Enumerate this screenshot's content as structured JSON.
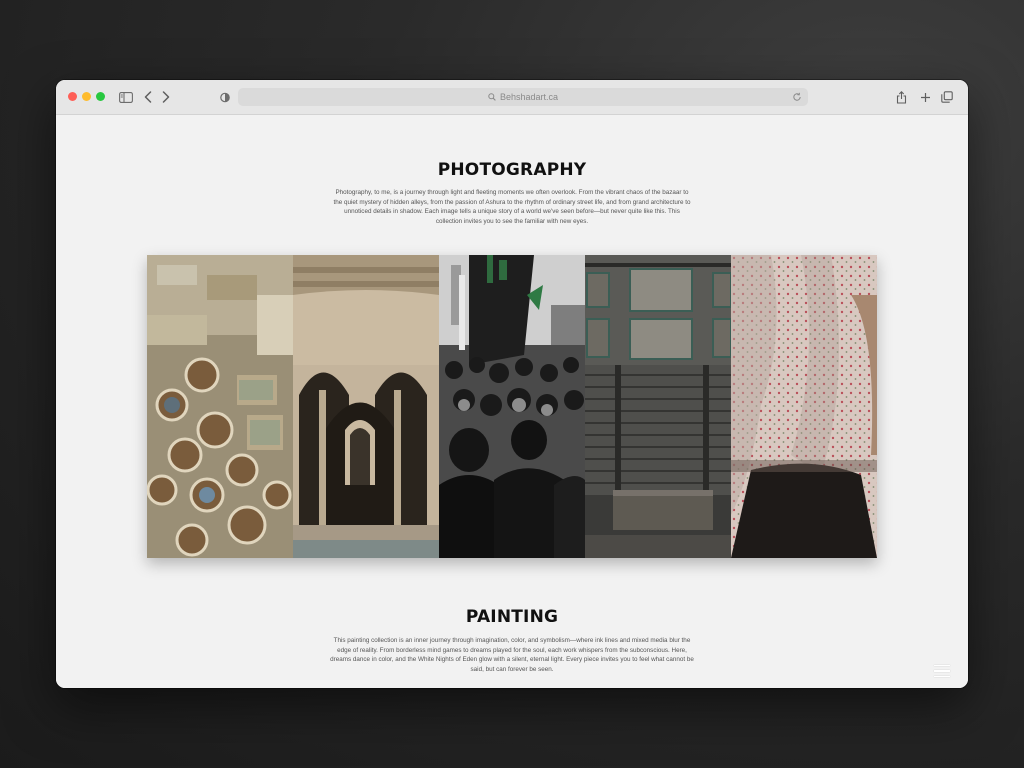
{
  "browser": {
    "url": "Behshadart.ca",
    "traffic_lights": {
      "close": "#fe5f57",
      "minimize": "#febc2e",
      "zoom": "#28c840"
    },
    "icons": {
      "sidebar": "sidebar-icon",
      "back": "chevron-left-icon",
      "forward": "chevron-right-icon",
      "privacy": "shield-icon",
      "search": "search-icon",
      "reload": "reload-icon",
      "share": "share-icon",
      "new_tab": "plus-icon",
      "tabs": "tab-overview-icon"
    }
  },
  "photography": {
    "title": "PHOTOGRAPHY",
    "description": "Photography, to me, is a journey through light and fleeting moments we often overlook. From the vibrant chaos of the bazaar to the quiet mystery of hidden alleys, from the passion of Ashura to the rhythm of ordinary street life, and from grand architecture to unnoticed details in shadow. Each image tells a unique story of a world we've seen before—but never quite like this. This collection invites you to see the familiar with new eyes.",
    "gallery": [
      "tannery-vats-photo",
      "courtyard-arches-photo",
      "ashura-crowd-photo",
      "shuttered-shop-photo",
      "floral-fabric-photo"
    ]
  },
  "painting": {
    "title": "PAINTING",
    "description": "This painting collection is an inner journey through imagination, color, and symbolism—where ink lines and mixed media blur the edge of reality. From borderless mind games to dreams played for the soul, each work whispers from the subconscious. Here, dreams dance in color, and the White Nights of Eden glow with a silent, eternal light. Every piece invites you to feel what cannot be said, but can forever be seen."
  },
  "menu": {
    "icon": "hamburger-menu-icon"
  }
}
